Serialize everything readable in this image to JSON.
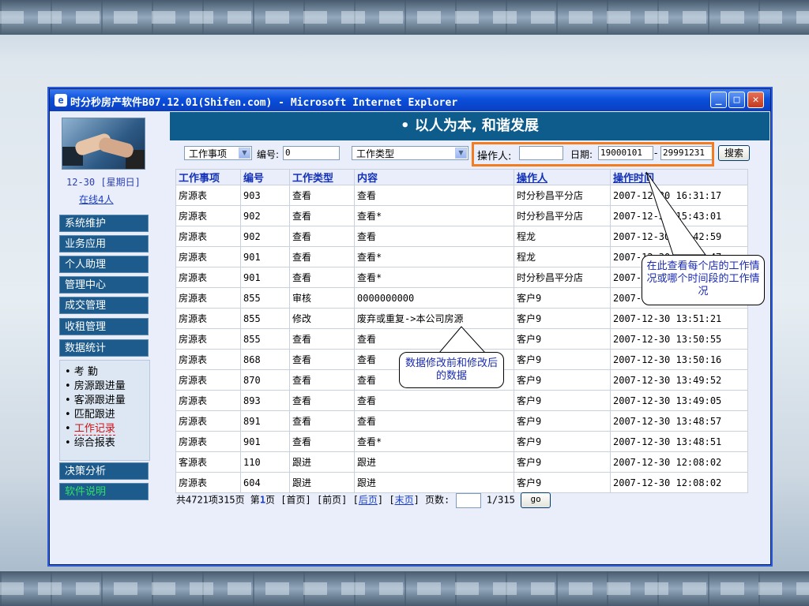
{
  "window": {
    "title": "时分秒房产软件B07.12.01(Shifen.com) - Microsoft Internet Explorer"
  },
  "header": {
    "slogan": "• 以人为本, 和谐发展"
  },
  "sidebar": {
    "date": "12-30 [星期日]",
    "online": "在线4人",
    "nav": [
      {
        "label": "系统维护"
      },
      {
        "label": "业务应用"
      },
      {
        "label": "个人助理"
      },
      {
        "label": "管理中心"
      },
      {
        "label": "成交管理"
      },
      {
        "label": "收租管理"
      },
      {
        "label": "数据统计"
      }
    ],
    "sub_items": [
      {
        "label": "• 考 勤"
      },
      {
        "label": "• 房源跟进量"
      },
      {
        "label": "• 客源跟进量"
      },
      {
        "label": "• 匹配跟进"
      },
      {
        "label": "工作记录"
      },
      {
        "label": "• 综合报表"
      }
    ],
    "nav_bottom": [
      {
        "label": "决策分析"
      },
      {
        "label": "软件说明"
      }
    ]
  },
  "filter": {
    "work_item_select": "工作事项",
    "number_label": "编号:",
    "number_value": "0",
    "work_type_select": "工作类型",
    "operator_label": "操作人:",
    "operator_value": "",
    "date_label": "日期:",
    "date_from": "19000101",
    "date_sep": "-",
    "date_to": "29991231",
    "search_label": "搜索"
  },
  "table": {
    "headers": [
      "工作事项",
      "编号",
      "工作类型",
      "内容",
      "操作人",
      "操作时间"
    ],
    "rows": [
      [
        "房源表",
        "903",
        "查看",
        "查看",
        "时分秒昌平分店",
        "2007-12-30 16:31:17"
      ],
      [
        "房源表",
        "902",
        "查看",
        "查看*",
        "时分秒昌平分店",
        "2007-12-30 15:43:01"
      ],
      [
        "房源表",
        "902",
        "查看",
        "查看",
        "程龙",
        "2007-12-30 15:42:59"
      ],
      [
        "房源表",
        "901",
        "查看",
        "查看*",
        "程龙",
        "2007-12-30 15:39:47"
      ],
      [
        "房源表",
        "901",
        "查看",
        "查看*",
        "时分秒昌平分店",
        "2007-12-30 [unclear]"
      ],
      [
        "房源表",
        "855",
        "审核",
        "0000000000",
        "客户9",
        "2007-12-30 [unclear]"
      ],
      [
        "房源表",
        "855",
        "修改",
        "废弃或重复->本公司房源",
        "客户9",
        "2007-12-30 13:51:21"
      ],
      [
        "房源表",
        "855",
        "查看",
        "查看",
        "客户9",
        "2007-12-30 13:50:55"
      ],
      [
        "房源表",
        "868",
        "查看",
        "查看",
        "客户9",
        "2007-12-30 13:50:16"
      ],
      [
        "房源表",
        "870",
        "查看",
        "查看",
        "客户9",
        "2007-12-30 13:49:52"
      ],
      [
        "房源表",
        "893",
        "查看",
        "查看",
        "客户9",
        "2007-12-30 13:49:05"
      ],
      [
        "房源表",
        "891",
        "查看",
        "查看",
        "客户9",
        "2007-12-30 13:48:57"
      ],
      [
        "房源表",
        "901",
        "查看",
        "查看*",
        "客户9",
        "2007-12-30 13:48:51"
      ],
      [
        "客源表",
        "110",
        "跟进",
        "跟进",
        "客户9",
        "2007-12-30 12:08:02"
      ],
      [
        "房源表",
        "604",
        "跟进",
        "跟进",
        "客户9",
        "2007-12-30 12:08:02"
      ]
    ]
  },
  "pager": {
    "summary": "共4721项315页 第",
    "current": "1",
    "page_suffix": "页 [首页] [前页] [",
    "next": "后页",
    "mid": "] [",
    "last": "末页",
    "end": "] 页数:",
    "total": "1/315",
    "go_label": "go"
  },
  "annotations": {
    "right_note": "在此查看每个店的工作情况或哪个时间段的工作情况",
    "middle_note": "数据修改前和修改后的数据"
  }
}
